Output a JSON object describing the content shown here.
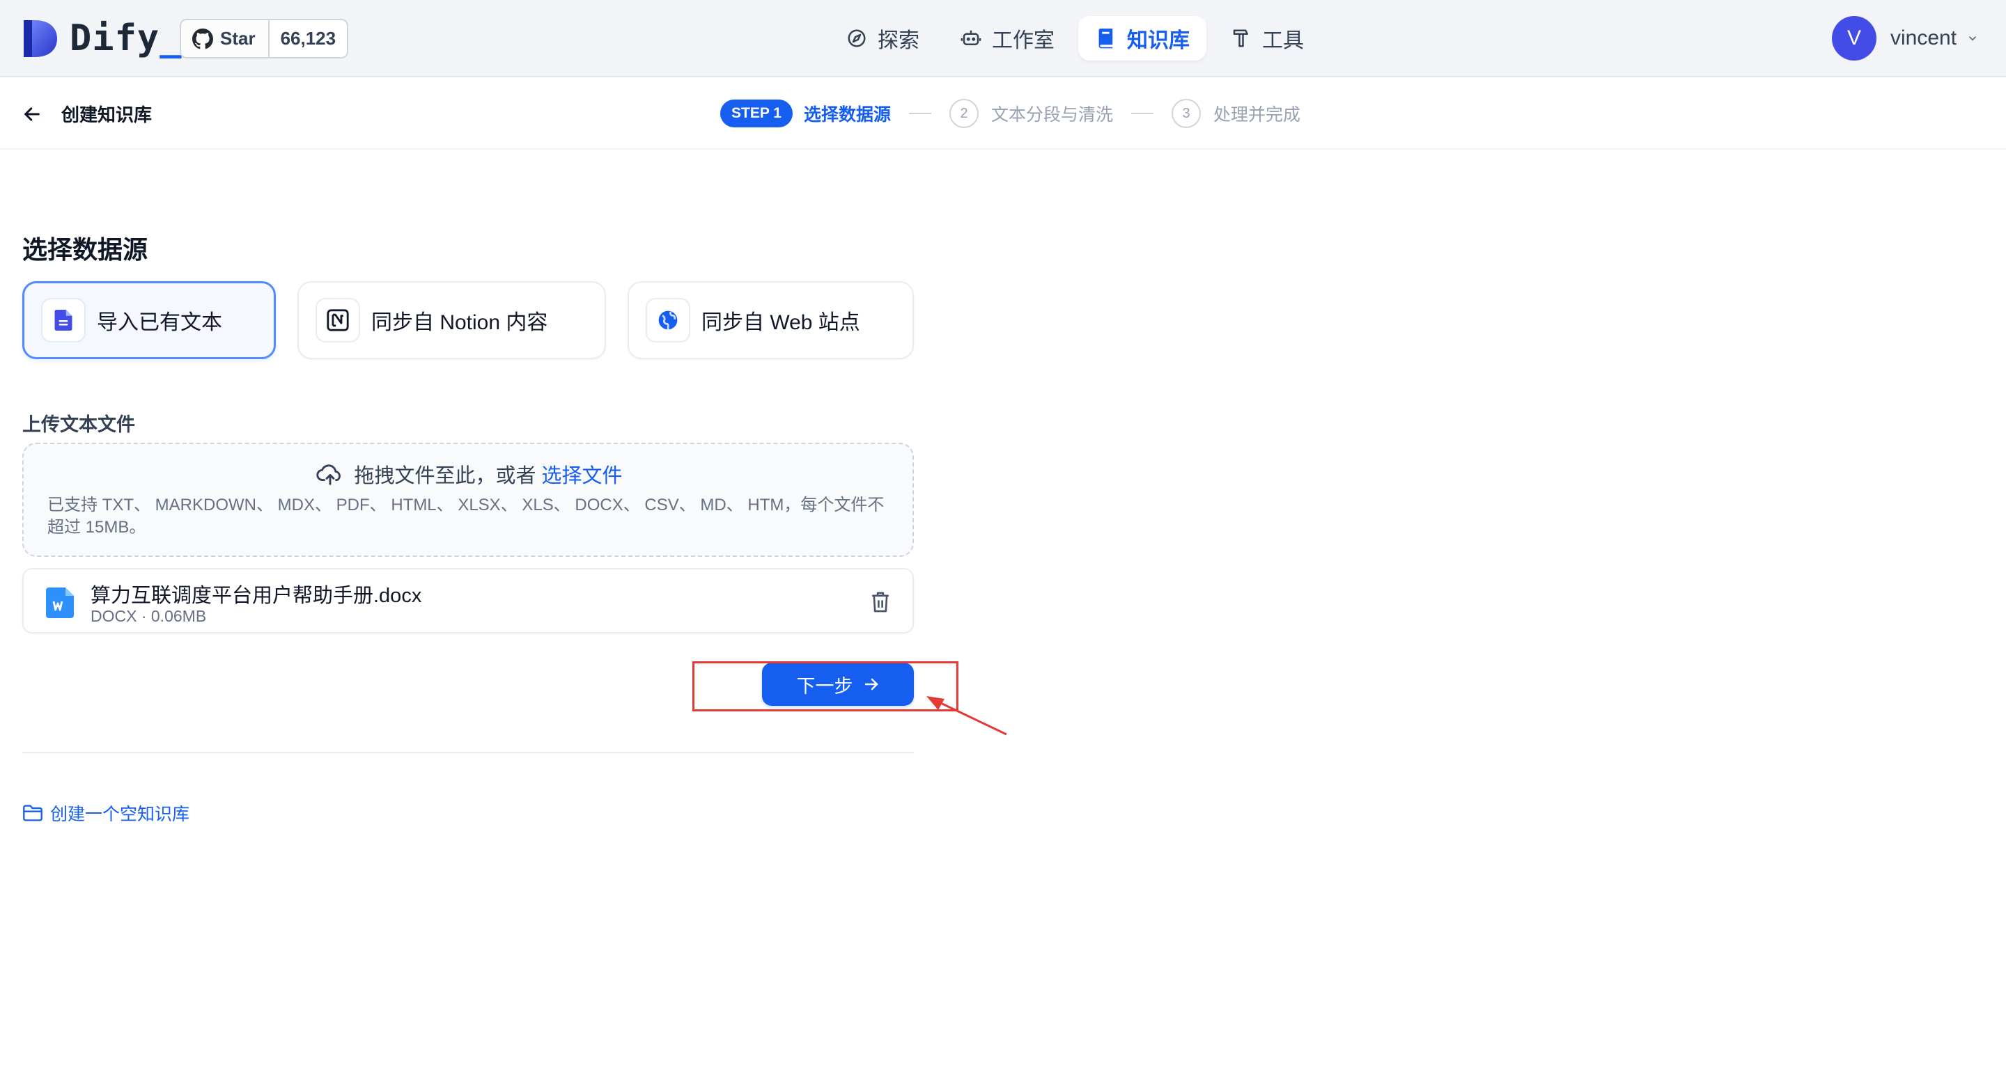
{
  "topbar": {
    "logo_text": "Dify",
    "logo_cursor": "_",
    "github": {
      "star_label": "Star",
      "count": "66,123"
    },
    "nav": [
      {
        "label": "探索",
        "icon": "compass-icon"
      },
      {
        "label": "工作室",
        "icon": "robot-icon"
      },
      {
        "label": "知识库",
        "icon": "book-icon",
        "active": true
      },
      {
        "label": "工具",
        "icon": "hammer-icon"
      }
    ],
    "user": {
      "initial": "V",
      "name": "vincent"
    }
  },
  "header": {
    "title": "创建知识库",
    "steps": [
      {
        "badge": "STEP 1",
        "label": "选择数据源",
        "active": true
      },
      {
        "badge": "2",
        "label": "文本分段与清洗"
      },
      {
        "badge": "3",
        "label": "处理并完成"
      }
    ]
  },
  "main": {
    "section_title": "选择数据源",
    "sources": [
      {
        "label": "导入已有文本",
        "icon": "file-text-icon",
        "active": true
      },
      {
        "label": "同步自 Notion 内容",
        "icon": "notion-icon"
      },
      {
        "label": "同步自 Web 站点",
        "icon": "globe-icon"
      }
    ],
    "upload": {
      "title": "上传文本文件",
      "drop_text": "拖拽文件至此，或者",
      "select_link": "选择文件",
      "help": "已支持 TXT、 MARKDOWN、 MDX、 PDF、 HTML、 XLSX、 XLS、 DOCX、 CSV、 MD、 HTM，每个文件不超过 15MB。"
    },
    "file": {
      "name": "算力互联调度平台用户帮助手册.docx",
      "meta": "DOCX · 0.06MB"
    },
    "next_button": "下一步",
    "empty_link": "创建一个空知识库"
  },
  "colors": {
    "accent": "#155eef",
    "avatar": "#444ce7",
    "annotation": "#e53935"
  }
}
